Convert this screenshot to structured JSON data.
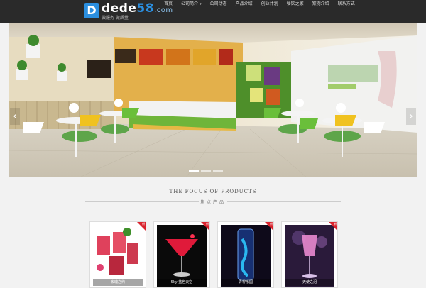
{
  "header": {
    "logo": {
      "mark": "D",
      "name": "dede",
      "num": "58",
      "domain": ".com",
      "tagline": "做服务 做质量"
    },
    "nav": [
      {
        "label": "首页",
        "has_caret": false
      },
      {
        "label": "公司简介",
        "has_caret": true
      },
      {
        "label": "公司动态",
        "has_caret": false
      },
      {
        "label": "产品介绍",
        "has_caret": false
      },
      {
        "label": "创业计划",
        "has_caret": false
      },
      {
        "label": "餐饮之家",
        "has_caret": false
      },
      {
        "label": "案例介绍",
        "has_caret": false
      },
      {
        "label": "联系方式",
        "has_caret": false
      }
    ]
  },
  "banner": {
    "arrow_left": "‹",
    "arrow_right": "›",
    "dots": 3,
    "active_dot": 0
  },
  "section": {
    "title": "THE FOCUS OF PRODUCTS",
    "subtitle": "焦点产品"
  },
  "products": [
    {
      "caption": "玫瑰之约",
      "badge": "新"
    },
    {
      "caption": "Sky 蓝色天空",
      "badge": "新"
    },
    {
      "caption": "青柠乐园",
      "badge": "新"
    },
    {
      "caption": "天使之泪",
      "badge": "新"
    }
  ],
  "colors": {
    "header_bg": "#2a2a2a",
    "accent": "#2b8fe0",
    "badge": "#d9232d"
  }
}
